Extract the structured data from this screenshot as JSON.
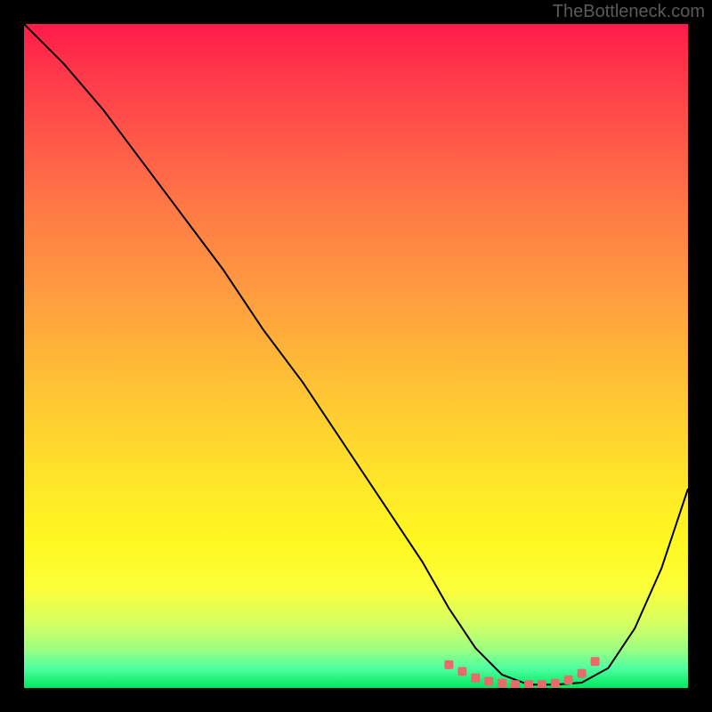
{
  "watermark": "TheBottleneck.com",
  "chart_data": {
    "type": "line",
    "title": "",
    "xlabel": "",
    "ylabel": "",
    "xlim": [
      0,
      100
    ],
    "ylim": [
      0,
      100
    ],
    "series": [
      {
        "name": "bottleneck-curve",
        "x": [
          0,
          6,
          12,
          18,
          24,
          30,
          36,
          42,
          48,
          54,
          60,
          64,
          68,
          72,
          76,
          80,
          84,
          88,
          92,
          96,
          100
        ],
        "y": [
          100,
          94,
          87,
          79,
          71,
          63,
          54,
          46,
          37,
          28,
          19,
          12,
          6,
          2,
          0.5,
          0.5,
          0.8,
          3,
          9,
          18,
          30
        ],
        "color": "#000000"
      },
      {
        "name": "optimal-markers",
        "x": [
          64,
          66,
          68,
          70,
          72,
          74,
          76,
          78,
          80,
          82,
          84,
          86
        ],
        "y": [
          3.5,
          2.5,
          1.5,
          1.0,
          0.7,
          0.5,
          0.5,
          0.5,
          0.7,
          1.2,
          2.2,
          4.0
        ],
        "color": "#e86a6a",
        "marker": "square"
      }
    ],
    "background": {
      "type": "vertical-gradient",
      "stops": [
        {
          "pos": 0,
          "color": "#ff1a4a"
        },
        {
          "pos": 50,
          "color": "#ffb638"
        },
        {
          "pos": 85,
          "color": "#fcff3a"
        },
        {
          "pos": 100,
          "color": "#00e860"
        }
      ]
    }
  }
}
